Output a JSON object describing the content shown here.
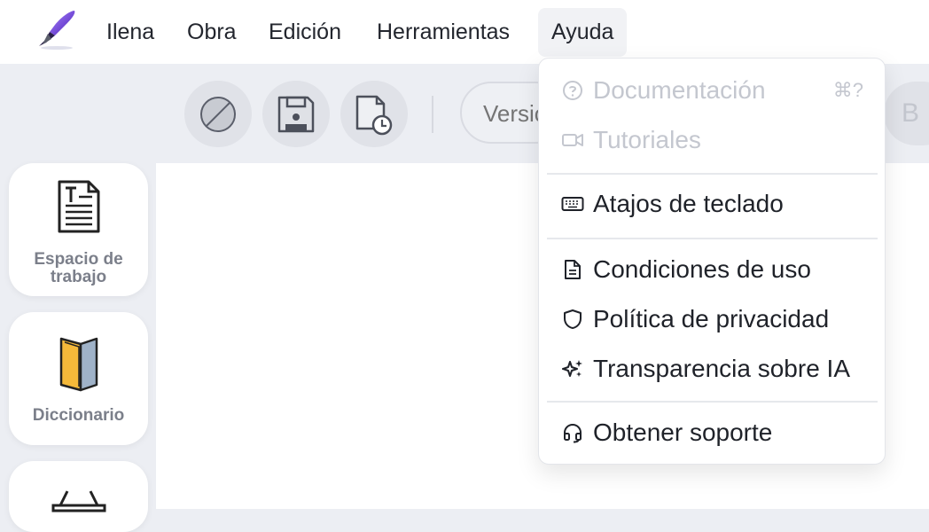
{
  "menubar": {
    "items": [
      {
        "label": "Ilena"
      },
      {
        "label": "Obra"
      },
      {
        "label": "Edición"
      },
      {
        "label": "Herramientas"
      },
      {
        "label": "Ayuda"
      }
    ],
    "active": "Ayuda"
  },
  "toolbar": {
    "version_placeholder": "Versión",
    "b_label": "B"
  },
  "sidebar": {
    "items": [
      {
        "label": "Espacio de trabajo",
        "icon": "document-text-icon"
      },
      {
        "label": "Diccionario",
        "icon": "book-icon"
      },
      {
        "label": "",
        "icon": "basket-icon"
      }
    ]
  },
  "help_menu": {
    "documentation": {
      "label": "Documentación",
      "shortcut": "⌘?",
      "enabled": false
    },
    "tutorials": {
      "label": "Tutoriales",
      "enabled": false
    },
    "shortcuts": {
      "label": "Atajos de teclado"
    },
    "terms": {
      "label": "Condiciones de uso"
    },
    "privacy": {
      "label": "Política de privacidad"
    },
    "ai": {
      "label": "Transparencia sobre IA"
    },
    "support": {
      "label": "Obtener soporte"
    }
  },
  "colors": {
    "background": "#eceef3",
    "accent_purple": "#6b3fd4",
    "disabled_text": "#c4c7cf"
  }
}
